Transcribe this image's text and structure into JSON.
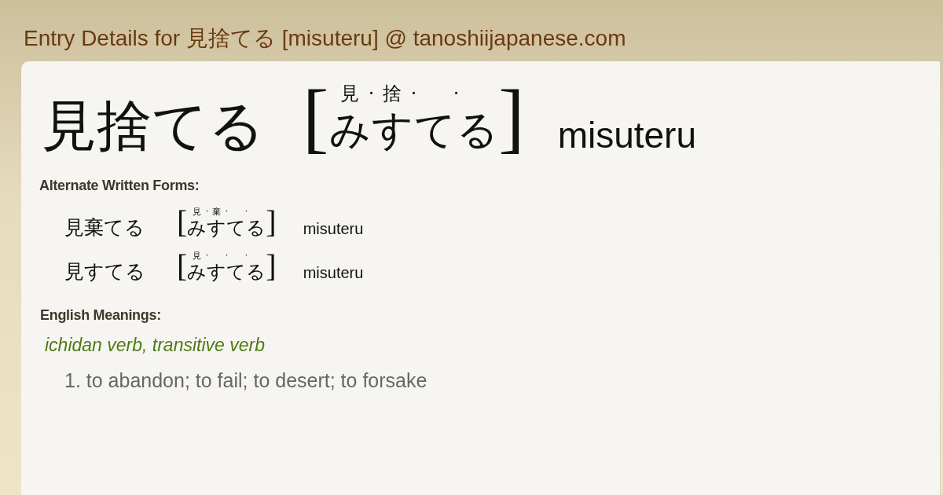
{
  "page_title": "Entry Details for 見捨てる [misuteru] @ tanoshiijapanese.com",
  "entry": {
    "word": "見捨てる",
    "open_bracket": "[",
    "reading": [
      {
        "kana": "み",
        "ruby": "見",
        "dot": "·"
      },
      {
        "kana": "す",
        "ruby": "捨",
        "dot": "·"
      },
      {
        "kana": "て",
        "dot": "·"
      },
      {
        "kana": "る"
      }
    ],
    "close_bracket": "]",
    "romaji": "misuteru"
  },
  "alternate_forms": {
    "heading": "Alternate Written Forms:",
    "items": [
      {
        "word": "見棄てる",
        "open_bracket": "[",
        "reading": [
          {
            "kana": "み",
            "ruby": "見",
            "dot": "·"
          },
          {
            "kana": "す",
            "ruby": "棄",
            "dot": "·"
          },
          {
            "kana": "て",
            "dot": "·"
          },
          {
            "kana": "る"
          }
        ],
        "close_bracket": "]",
        "romaji": "misuteru"
      },
      {
        "word": "見すてる",
        "open_bracket": "[",
        "reading": [
          {
            "kana": "み",
            "ruby": "見",
            "dot": "·"
          },
          {
            "kana": "す",
            "dot": "·"
          },
          {
            "kana": "て",
            "dot": "·"
          },
          {
            "kana": "る"
          }
        ],
        "close_bracket": "]",
        "romaji": "misuteru"
      }
    ]
  },
  "meanings": {
    "heading": "English Meanings:",
    "groups": [
      {
        "part_of_speech": "ichidan verb, transitive verb",
        "senses": [
          "1. to abandon; to fail; to desert; to forsake"
        ]
      }
    ]
  }
}
